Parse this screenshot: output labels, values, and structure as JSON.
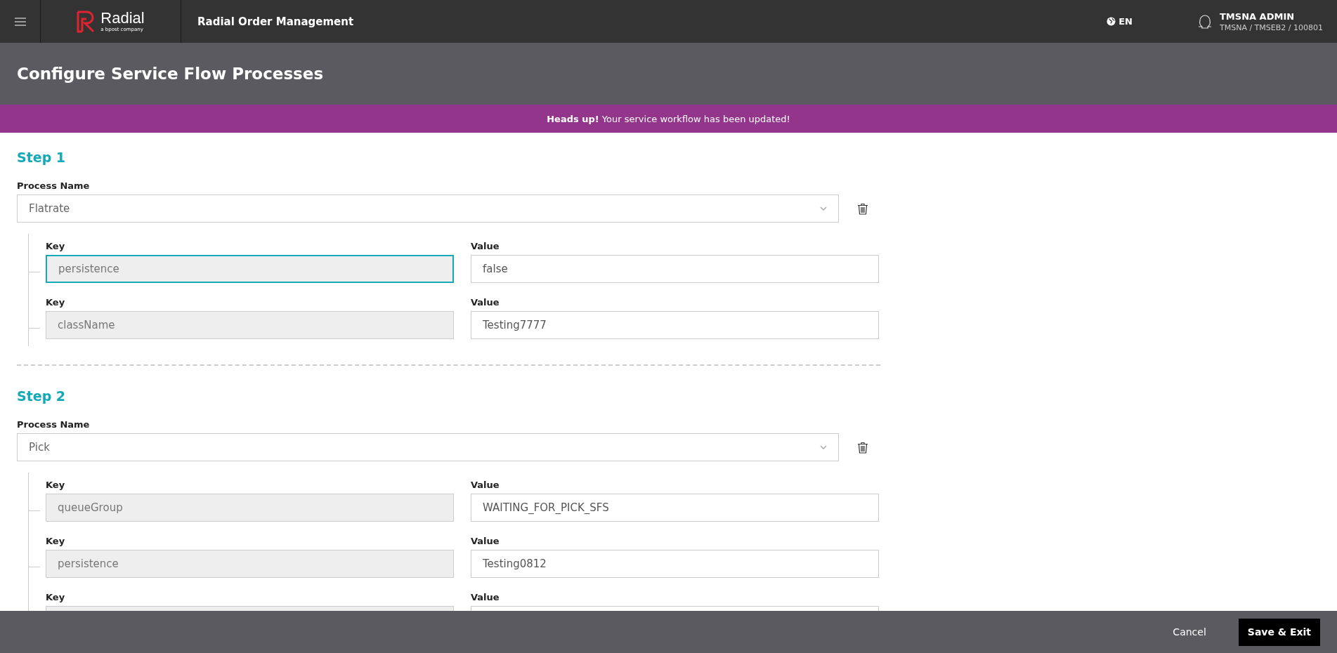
{
  "header": {
    "logo": {
      "name": "Radial",
      "tagline": "a bpost company"
    },
    "app_title": "Radial Order Management",
    "language": "EN",
    "user": {
      "name": "TMSNA ADMIN",
      "context": "TMSNA / TMSEB2 / 100801"
    }
  },
  "page_title": "Configure Service Flow Processes",
  "banner": "**Heads up!** Your service workflow has been updated!",
  "steps": [
    {
      "title": "Step 1",
      "process_label": "Process Name",
      "process": "Flatrate",
      "params": [
        {
          "key_label": "Key",
          "key": "persistence",
          "value_label": "Value",
          "value": "false",
          "focused": true
        },
        {
          "key_label": "Key",
          "key": "className",
          "value_label": "Value",
          "value": "Testing7777",
          "focused": false
        }
      ]
    },
    {
      "title": "Step 2",
      "process_label": "Process Name",
      "process": "Pick",
      "params": [
        {
          "key_label": "Key",
          "key": "queueGroup",
          "value_label": "Value",
          "value": "WAITING_FOR_PICK_SFS",
          "focused": false
        },
        {
          "key_label": "Key",
          "key": "persistence",
          "value_label": "Value",
          "value": "Testing0812",
          "focused": false
        },
        {
          "key_label": "Key",
          "value_label": "Value",
          "focused": false
        }
      ]
    }
  ],
  "footer": {
    "cancel": "Cancel",
    "save": "Save & Exit"
  }
}
